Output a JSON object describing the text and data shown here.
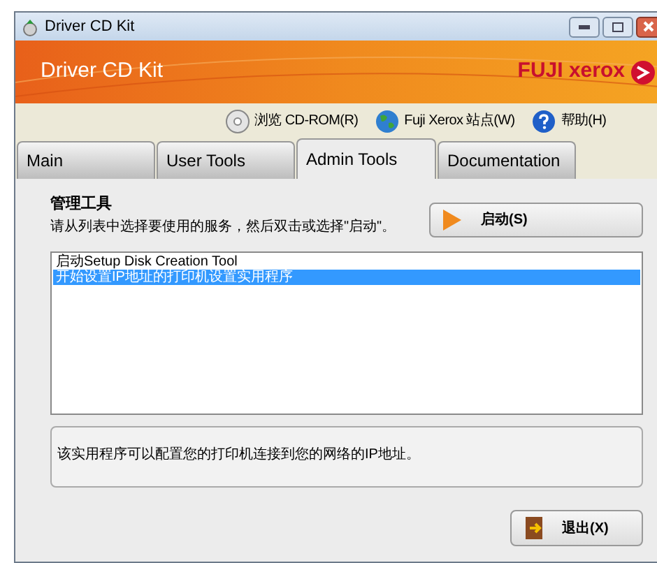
{
  "window": {
    "title": "Driver CD Kit"
  },
  "banner": {
    "title": "Driver CD Kit",
    "logo": "FUJI xerox"
  },
  "toolbar": [
    {
      "kind": "cd",
      "label": "浏览 CD-ROM(R)"
    },
    {
      "kind": "globe",
      "label": "Fuji Xerox 站点(W)"
    },
    {
      "kind": "help",
      "label": "帮助(H)"
    }
  ],
  "tabs": [
    {
      "label": "Main",
      "selected": false
    },
    {
      "label": "User Tools",
      "selected": false
    },
    {
      "label": "Admin Tools",
      "selected": true
    },
    {
      "label": "Documentation",
      "selected": false
    }
  ],
  "panel": {
    "heading": "管理工具",
    "instruction": "请从列表中选择要使用的服务，然后双击或选择\"启动\"。",
    "start_button": "启动(S)",
    "list": [
      {
        "label": "启动Setup Disk Creation Tool",
        "selected": false
      },
      {
        "label": "开始设置IP地址的打印机设置实用程序",
        "selected": true
      }
    ],
    "description": "该实用程序可以配置您的打印机连接到您的网络的IP地址。",
    "exit_button": "退出(X)"
  }
}
